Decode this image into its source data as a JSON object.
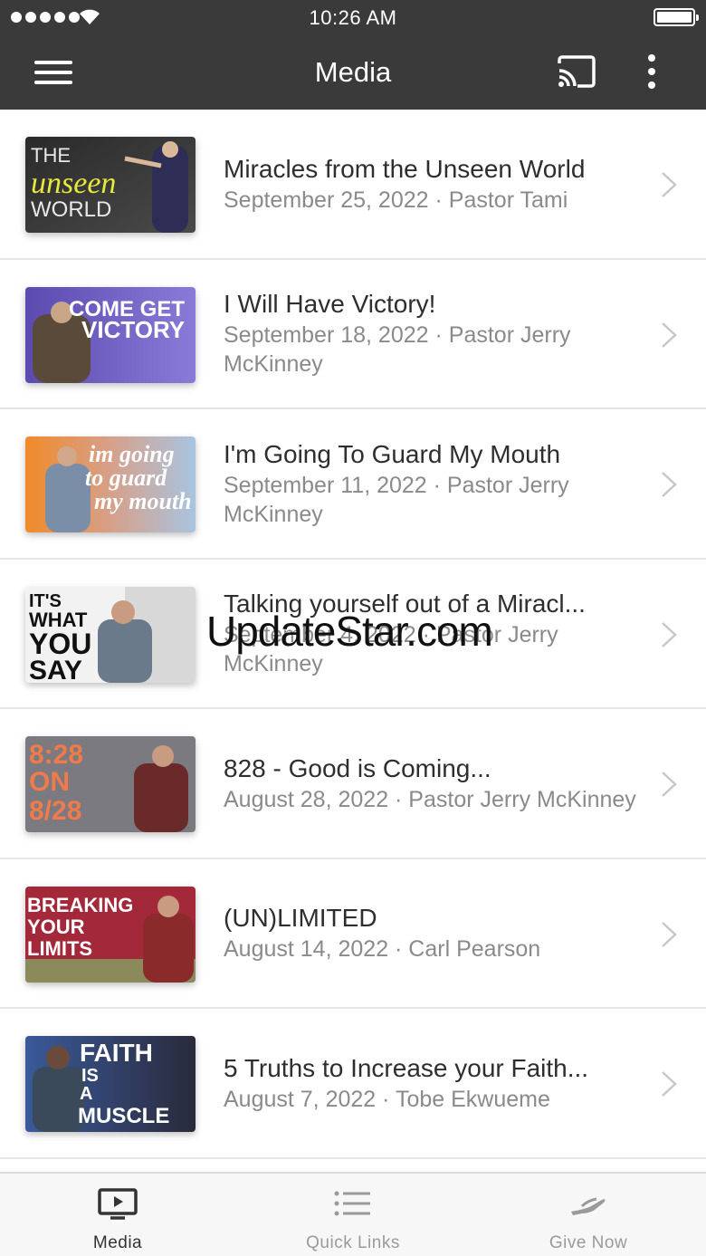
{
  "status_bar": {
    "time": "10:26 AM"
  },
  "nav": {
    "title": "Media"
  },
  "watermark": "UpdateStar.com",
  "items": [
    {
      "title": "Miracles from the Unseen World",
      "subtitle": "September 25, 2022 · Pastor Tami",
      "thumb_text": [
        "THE",
        "unseen",
        "WORLD"
      ]
    },
    {
      "title": "I Will Have Victory!",
      "subtitle": "September 18, 2022 · Pastor Jerry McKinney",
      "thumb_text": [
        "COME GET",
        "VICTORY"
      ]
    },
    {
      "title": "I'm Going To Guard My Mouth",
      "subtitle": "September 11, 2022 · Pastor Jerry McKinney",
      "thumb_text": [
        "im going",
        "to guard",
        "my mouth"
      ]
    },
    {
      "title": "Talking yourself out of a Miracl...",
      "subtitle": "September 4, 2022 · Pastor Jerry McKinney",
      "thumb_text": [
        "IT'S",
        "WHAT",
        "YOU",
        "SAY"
      ]
    },
    {
      "title": "828 - Good is Coming...",
      "subtitle": "August 28, 2022 · Pastor Jerry McKinney",
      "thumb_text": [
        "8:28",
        "ON",
        "8/28"
      ]
    },
    {
      "title": "(UN)LIMITED",
      "subtitle": "August 14, 2022 · Carl Pearson",
      "thumb_text": [
        "BREAKING",
        "YOUR",
        "LIMITS"
      ]
    },
    {
      "title": "5 Truths to Increase your Faith...",
      "subtitle": "August 7, 2022 · Tobe Ekwueme",
      "thumb_text": [
        "FAITH",
        "IS",
        "A",
        "MUSCLE"
      ]
    }
  ],
  "tabs": [
    {
      "label": "Media",
      "icon": "tv-play-icon",
      "active": true
    },
    {
      "label": "Quick Links",
      "icon": "list-icon",
      "active": false
    },
    {
      "label": "Give Now",
      "icon": "giving-hand-icon",
      "active": false
    }
  ]
}
